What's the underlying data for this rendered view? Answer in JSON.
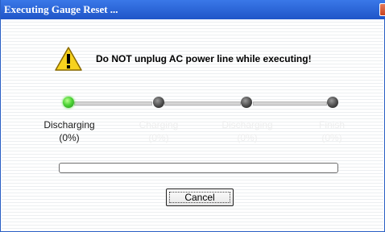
{
  "window": {
    "title": "Executing Gauge Reset ..."
  },
  "warning": {
    "icon": "warning-icon",
    "message": "Do NOT unplug AC power line while executing!"
  },
  "steps": [
    {
      "name": "Discharging",
      "percent": "(0%)",
      "state": "active"
    },
    {
      "name": "Charging",
      "percent": "(0%)",
      "state": "pending"
    },
    {
      "name": "Discharging",
      "percent": "(0%)",
      "state": "pending"
    },
    {
      "name": "Finish",
      "percent": "(0%)",
      "state": "pending"
    }
  ],
  "progress": {
    "value": 0
  },
  "buttons": {
    "cancel": "Cancel"
  },
  "colors": {
    "titlebar": "#1f55c8",
    "active": "#4ed437",
    "pending": "#444444"
  }
}
